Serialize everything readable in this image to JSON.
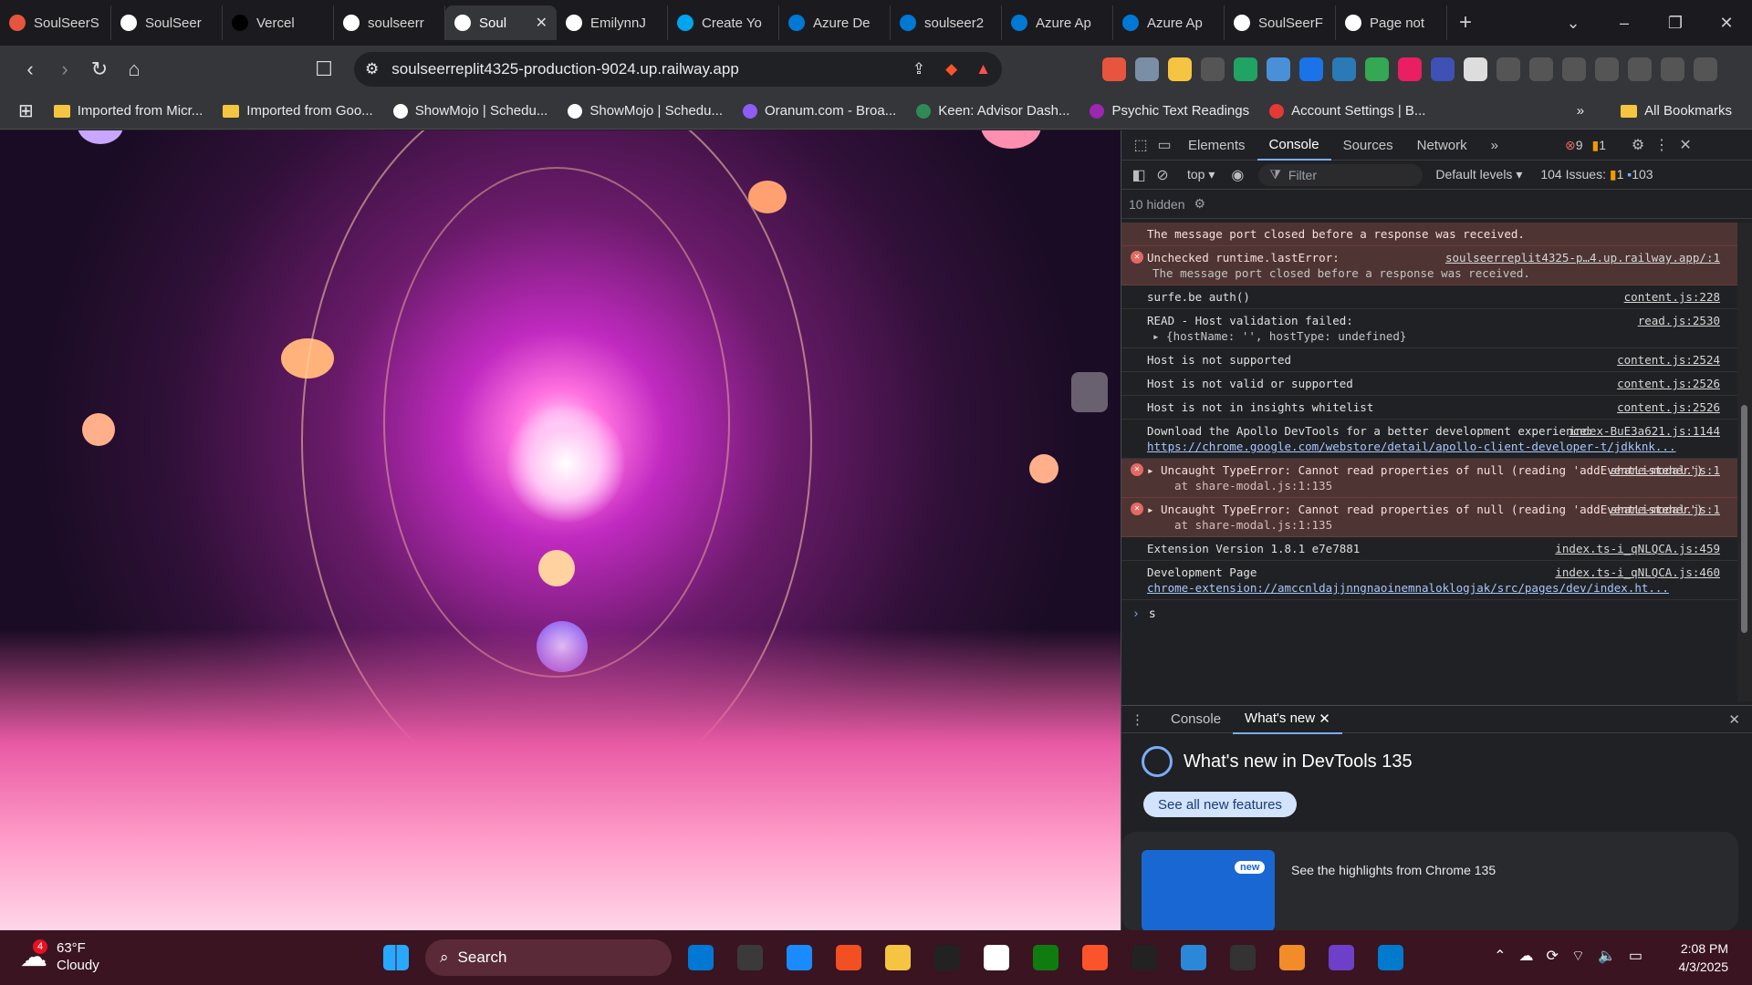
{
  "tabs": [
    {
      "label": "SoulSeerS",
      "color": "#e8553e"
    },
    {
      "label": "SoulSeer",
      "color": "#ffffff"
    },
    {
      "label": "Vercel",
      "color": "#000000"
    },
    {
      "label": "soulseerr",
      "color": "#ffffff"
    },
    {
      "label": "Soul",
      "color": "#ffffff"
    },
    {
      "label": "EmilynnJ",
      "color": "#ffffff"
    },
    {
      "label": "Create Yo",
      "color": "#00a4ef"
    },
    {
      "label": "Azure De",
      "color": "#0078d4"
    },
    {
      "label": "soulseer2",
      "color": "#0078d4"
    },
    {
      "label": "Azure Ap",
      "color": "#0078d4"
    },
    {
      "label": "Azure Ap",
      "color": "#0078d4"
    },
    {
      "label": "SoulSeerF",
      "color": "#ffffff"
    },
    {
      "label": "Page not",
      "color": "#ffffff"
    }
  ],
  "active_tab_index": 4,
  "window": {
    "new_tab": "+",
    "dropdown": "⌄",
    "minimize": "–",
    "restore": "❐",
    "close": "✕"
  },
  "omnibox": {
    "url": "soulseerreplit4325-production-9024.up.railway.app"
  },
  "bookmarks": [
    {
      "label": "Imported from Micr...",
      "kind": "folder"
    },
    {
      "label": "Imported from Goo...",
      "kind": "folder"
    },
    {
      "label": "ShowMojo | Schedu...",
      "kind": "site",
      "color": "#ffffff"
    },
    {
      "label": "ShowMojo | Schedu...",
      "kind": "site",
      "color": "#ffffff"
    },
    {
      "label": "Oranum.com - Broa...",
      "kind": "site",
      "color": "#8e5cf7"
    },
    {
      "label": "Keen: Advisor Dash...",
      "kind": "site",
      "color": "#2e8b57"
    },
    {
      "label": "Psychic Text Readings",
      "kind": "site",
      "color": "#9c27b0"
    },
    {
      "label": "Account Settings | B...",
      "kind": "site",
      "color": "#e53935"
    }
  ],
  "bookmarks_more": "»",
  "all_bookmarks": "All Bookmarks",
  "devtools": {
    "tabs": [
      "Elements",
      "Console",
      "Sources",
      "Network"
    ],
    "active_tab": "Console",
    "more_tabs": "»",
    "error_count": "9",
    "warning_count": "1",
    "context": "top",
    "filter_placeholder": "Filter",
    "levels": "Default levels",
    "issues_label": "104 Issues:",
    "issues_warn": "1",
    "issues_info": "103",
    "hidden": "10 hidden",
    "messages": [
      {
        "type": "err",
        "text": "The message port closed before a response was received.",
        "source": ""
      },
      {
        "type": "err",
        "text": "Unchecked runtime.lastError:",
        "source": "soulseerreplit4325-p…4.up.railway.app/:1",
        "sub": "The message port closed before a response was received."
      },
      {
        "type": "log",
        "text": "surfe.be auth()",
        "source": "content.js:228"
      },
      {
        "type": "log",
        "text": "READ - Host validation failed:",
        "source": "read.js:2530",
        "sub": "▸ {hostName: '', hostType: undefined}"
      },
      {
        "type": "log",
        "text": "Host is not supported",
        "source": "content.js:2524"
      },
      {
        "type": "log",
        "text": "Host is not valid or supported",
        "source": "content.js:2526"
      },
      {
        "type": "log",
        "text": "Host is not in insights whitelist",
        "source": "content.js:2526"
      },
      {
        "type": "log",
        "text": "Download the Apollo DevTools for a better development experience:",
        "source": "index-BuE3a621.js:1144",
        "link": "https://chrome.google.com/webstore/detail/apollo-client-developer-t/jdkknk..."
      },
      {
        "type": "err",
        "text": "▸ Uncaught TypeError: Cannot read properties of null (reading 'addEventListener')",
        "source": "share-modal.js:1",
        "at": "at share-modal.js:1:135"
      },
      {
        "type": "err",
        "text": "▸ Uncaught TypeError: Cannot read properties of null (reading 'addEventListener')",
        "source": "share-modal.js:1",
        "at": "at share-modal.js:1:135"
      },
      {
        "type": "log",
        "text": "Extension Version 1.8.1 e7e7881",
        "source": "index.ts-i_qNLQCA.js:459"
      },
      {
        "type": "log",
        "text": "Development Page",
        "source": "index.ts-i_qNLQCA.js:460",
        "link": "chrome-extension://amccnldajjnngnaoinemnaloklogjak/src/pages/dev/index.ht..."
      }
    ],
    "prompt": "s",
    "drawer": {
      "tabs": [
        "Console",
        "What's new"
      ],
      "active": "What's new",
      "title": "What's new in DevTools 135",
      "button": "See all new features",
      "badge": "new",
      "highlight": "See the highlights from Chrome 135"
    }
  },
  "taskbar": {
    "temp": "63°F",
    "condition": "Cloudy",
    "weather_badge": "4",
    "search": "Search",
    "time": "2:08 PM",
    "date": "4/3/2025",
    "apps": [
      "#0078d4",
      "#3a3a3a",
      "#1a8cff",
      "#f25022",
      "#f5c542",
      "#222222",
      "#ffffff",
      "#107c10",
      "#fb542b",
      "#222222",
      "#2b88d8",
      "#333333",
      "#f28c28",
      "#6e40c9",
      "#007acc"
    ]
  }
}
